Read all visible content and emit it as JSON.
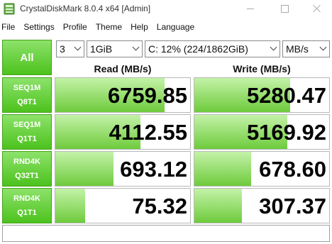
{
  "window": {
    "title": "CrystalDiskMark 8.0.4 x64 [Admin]",
    "icon": "app-icon"
  },
  "menu": [
    "File",
    "Settings",
    "Profile",
    "Theme",
    "Help",
    "Language"
  ],
  "controls": {
    "all_label": "All",
    "count": "3",
    "size": "1GiB",
    "drive": "C: 12% (224/1862GiB)",
    "unit": "MB/s"
  },
  "headers": {
    "read": "Read (MB/s)",
    "write": "Write (MB/s)"
  },
  "rows": [
    {
      "line1": "SEQ1M",
      "line2": "Q8T1",
      "read": "6759.85",
      "write": "5280.47",
      "read_fill": 0.81,
      "write_fill": 0.71
    },
    {
      "line1": "SEQ1M",
      "line2": "Q1T1",
      "read": "4112.55",
      "write": "5169.92",
      "read_fill": 0.63,
      "write_fill": 0.69
    },
    {
      "line1": "RND4K",
      "line2": "Q32T1",
      "read": "693.12",
      "write": "678.60",
      "read_fill": 0.43,
      "write_fill": 0.42
    },
    {
      "line1": "RND4K",
      "line2": "Q1T1",
      "read": "75.32",
      "write": "307.37",
      "read_fill": 0.22,
      "write_fill": 0.35
    }
  ],
  "colors": {
    "button_green_top": "#8de26a",
    "button_green_bottom": "#4cc21d",
    "bar_green": "#6ecb3c"
  }
}
